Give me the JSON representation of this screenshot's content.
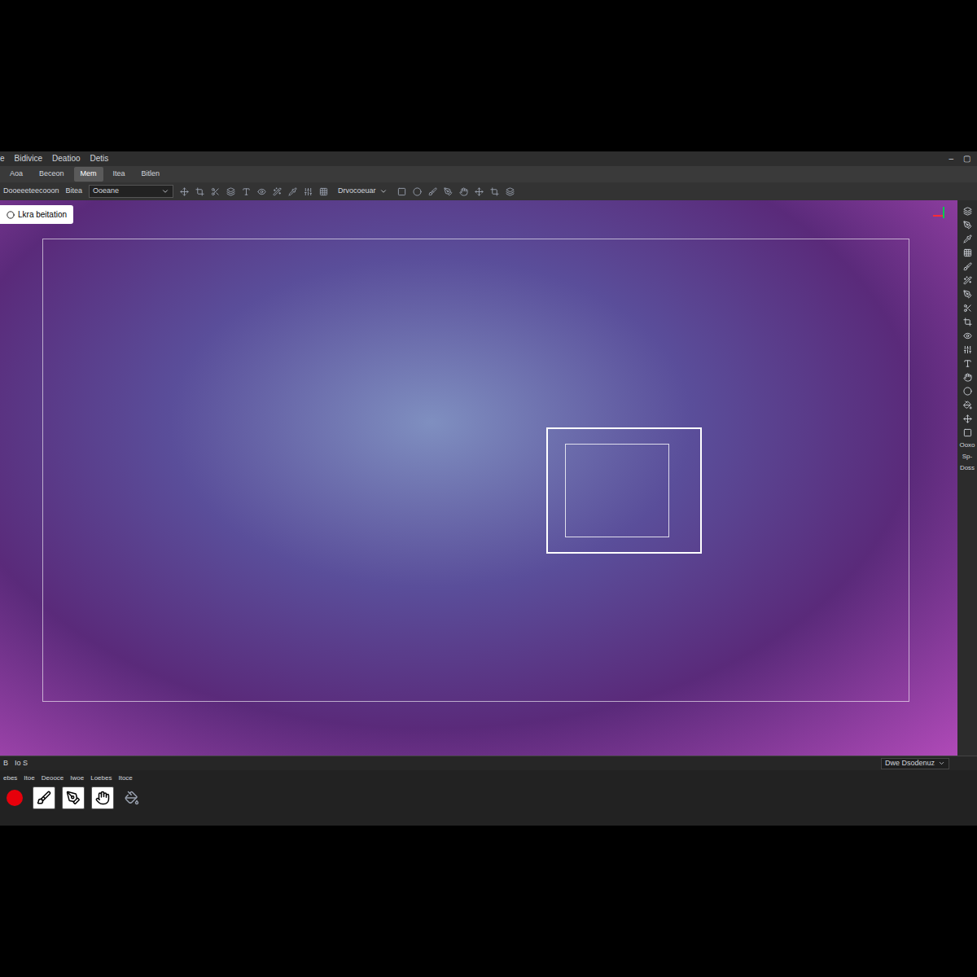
{
  "window": {
    "controls": [
      "–",
      "▢"
    ]
  },
  "menu": [
    "e",
    "Bidivice",
    "Deatioo",
    "Detis"
  ],
  "tabs": [
    {
      "label": "Aoa",
      "selected": false
    },
    {
      "label": "Beceon",
      "selected": false
    },
    {
      "label": "Mem",
      "selected": true
    },
    {
      "label": "Itea",
      "selected": false
    },
    {
      "label": "Bitlen",
      "selected": false
    }
  ],
  "toolbar": {
    "project": "Dooeeeteecooon",
    "mode": "Bitea",
    "preset": "Ooeane",
    "view": "Drvocoeuar"
  },
  "canvas": {
    "label": "Lkra beitation",
    "selection_active": true
  },
  "right_panel": {
    "labels": [
      "Ooxo",
      "Sp-",
      "Doss"
    ]
  },
  "timeline": {
    "controls": [
      "B",
      "Io S"
    ],
    "view": "Dwe Dsodenuz",
    "labels": [
      "ebes",
      "Itoe",
      "Deooce",
      "Iwoe",
      "Loebes",
      "Itoce"
    ]
  }
}
